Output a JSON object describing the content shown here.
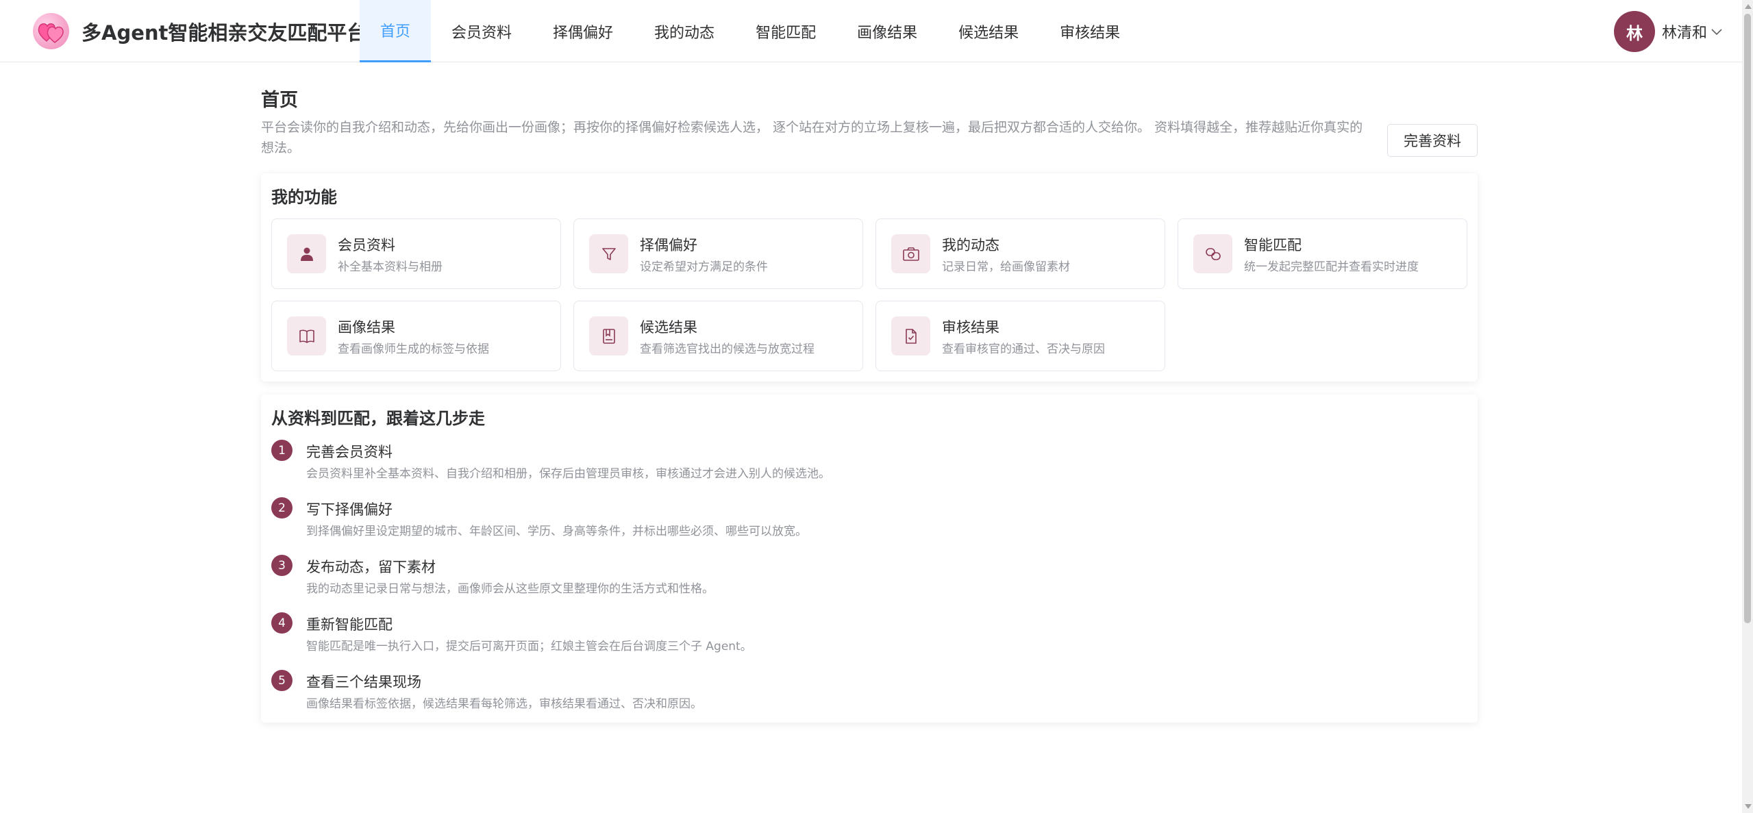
{
  "app": {
    "title": "多Agent智能相亲交友匹配平台"
  },
  "nav": [
    {
      "label": "首页",
      "active": true
    },
    {
      "label": "会员资料",
      "active": false
    },
    {
      "label": "择偶偏好",
      "active": false
    },
    {
      "label": "我的动态",
      "active": false
    },
    {
      "label": "智能匹配",
      "active": false
    },
    {
      "label": "画像结果",
      "active": false
    },
    {
      "label": "候选结果",
      "active": false
    },
    {
      "label": "审核结果",
      "active": false
    }
  ],
  "user": {
    "avatar_text": "林",
    "name": "林清和"
  },
  "page": {
    "title": "首页",
    "intro": "平台会读你的自我介绍和动态，先给你画出一份画像；再按你的择偶偏好检索候选人选， 逐个站在对方的立场上复核一遍，最后把双方都合适的人交给你。 资料填得越全，推荐越贴近你真实的想法。",
    "complete_button": "完善资料"
  },
  "functions": {
    "title": "我的功能",
    "items": [
      {
        "name": "会员资料",
        "desc": "补全基本资料与相册",
        "icon": "user-icon"
      },
      {
        "name": "择偶偏好",
        "desc": "设定希望对方满足的条件",
        "icon": "filter-icon"
      },
      {
        "name": "我的动态",
        "desc": "记录日常，给画像留素材",
        "icon": "camera-icon"
      },
      {
        "name": "智能匹配",
        "desc": "统一发起完整匹配并查看实时进度",
        "icon": "link-icon"
      },
      {
        "name": "画像结果",
        "desc": "查看画像师生成的标签与依据",
        "icon": "book-icon"
      },
      {
        "name": "候选结果",
        "desc": "查看筛选官找出的候选与放宽过程",
        "icon": "bookmark-icon"
      },
      {
        "name": "审核结果",
        "desc": "查看审核官的通过、否决与原因",
        "icon": "document-check-icon"
      }
    ]
  },
  "steps": {
    "title": "从资料到匹配，跟着这几步走",
    "items": [
      {
        "num": "1",
        "title": "完善会员资料",
        "desc": "会员资料里补全基本资料、自我介绍和相册，保存后由管理员审核，审核通过才会进入别人的候选池。"
      },
      {
        "num": "2",
        "title": "写下择偶偏好",
        "desc": "到择偶偏好里设定期望的城市、年龄区间、学历、身高等条件，并标出哪些必须、哪些可以放宽。"
      },
      {
        "num": "3",
        "title": "发布动态，留下素材",
        "desc": "我的动态里记录日常与想法，画像师会从这些原文里整理你的生活方式和性格。"
      },
      {
        "num": "4",
        "title": "重新智能匹配",
        "desc": "智能匹配是唯一执行入口，提交后可离开页面；红娘主管会在后台调度三个子 Agent。"
      },
      {
        "num": "5",
        "title": "查看三个结果现场",
        "desc": "画像结果看标签依据，候选结果看每轮筛选，审核结果看通过、否决和原因。"
      }
    ]
  },
  "colors": {
    "accent": "#409eff",
    "brand": "#8b3a55",
    "icon_bg": "#f6e9ee"
  }
}
